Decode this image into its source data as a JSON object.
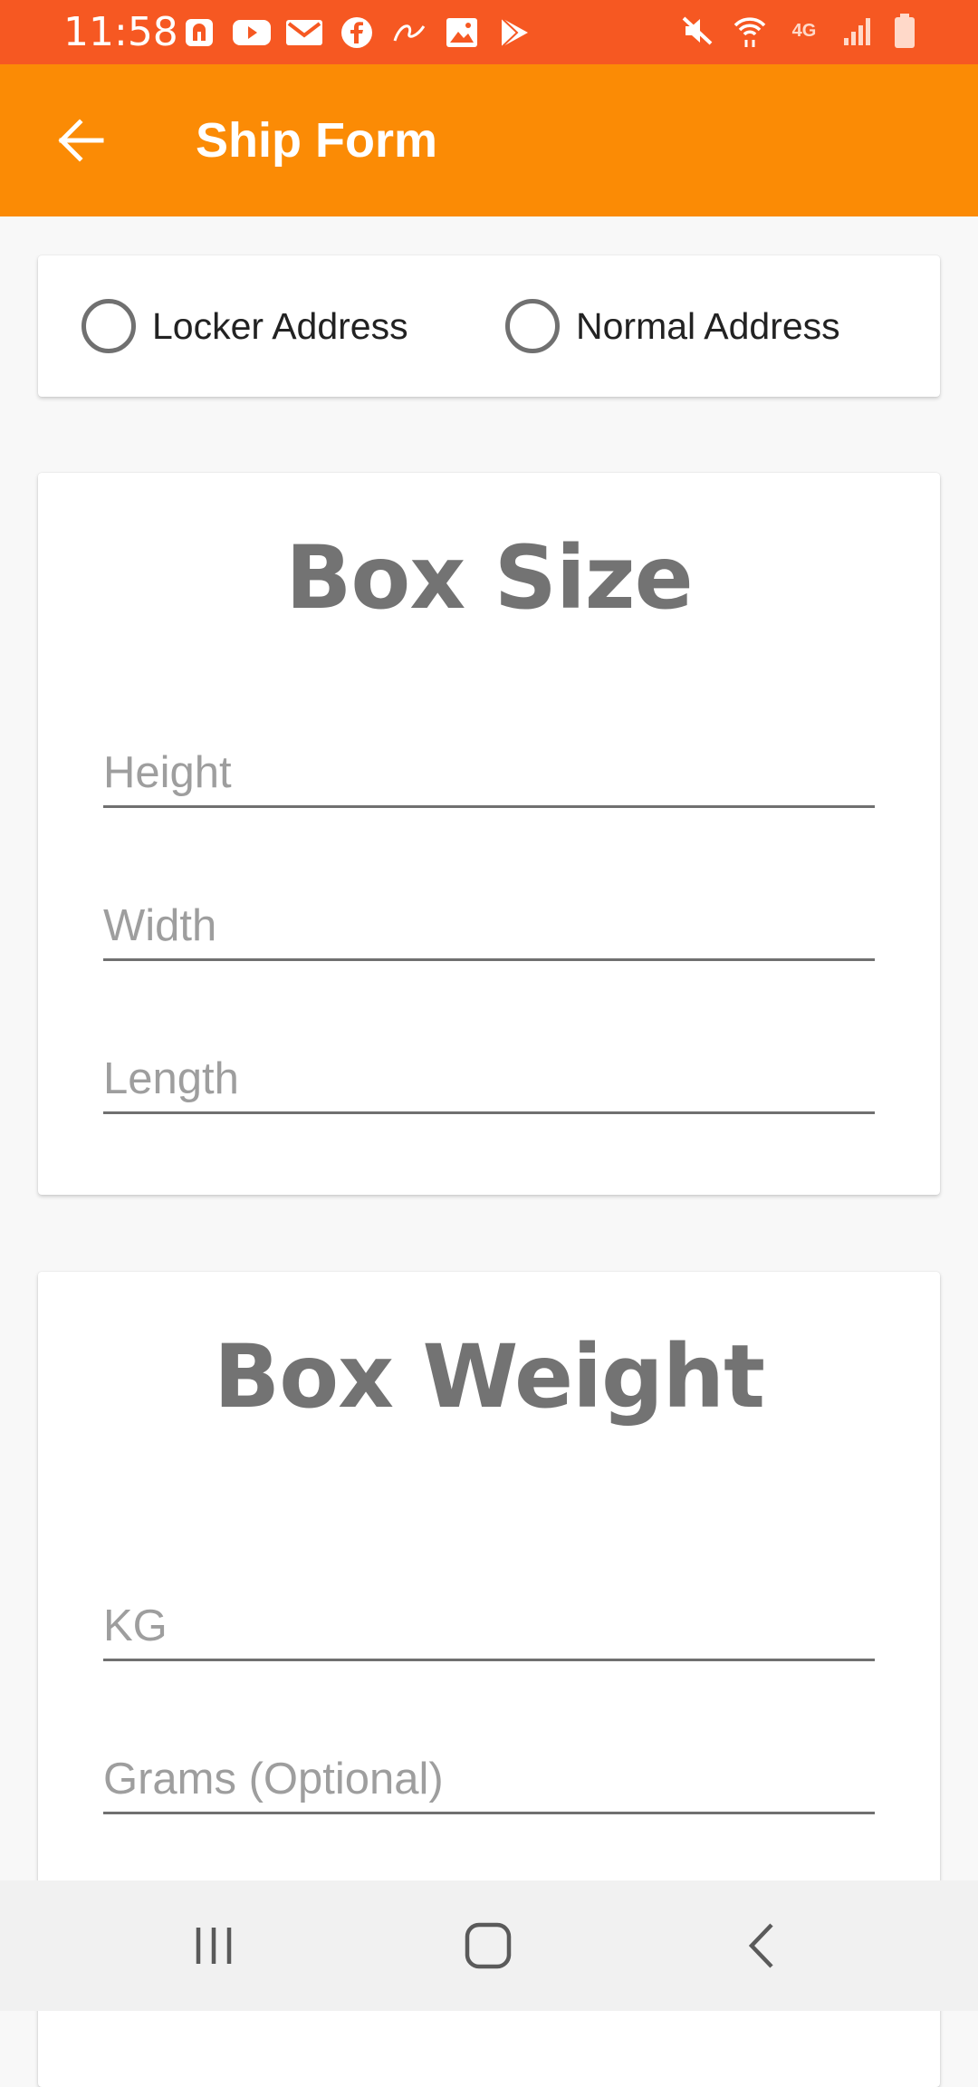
{
  "status_bar": {
    "time": "11:58",
    "left_icons": [
      "app-notification-icon",
      "youtube-icon",
      "gmail-icon",
      "facebook-icon",
      "app-icon",
      "gallery-icon",
      "play-store-icon"
    ],
    "right_icons": [
      "mute-icon",
      "wifi-icon",
      "lte-icon",
      "signal-icon",
      "battery-icon"
    ],
    "network_label": "4G",
    "color": "#f65822"
  },
  "app_bar": {
    "title": "Ship Form",
    "color": "#fb8b05"
  },
  "address_type": {
    "options": [
      {
        "label": "Locker Address",
        "selected": false
      },
      {
        "label": "Normal Address",
        "selected": false
      }
    ]
  },
  "box_size": {
    "heading": "Box Size",
    "fields": [
      {
        "placeholder": "Height",
        "value": ""
      },
      {
        "placeholder": "Width",
        "value": ""
      },
      {
        "placeholder": "Length",
        "value": ""
      }
    ]
  },
  "box_weight": {
    "heading": "Box Weight",
    "fields": [
      {
        "placeholder": "KG",
        "value": ""
      },
      {
        "placeholder": "Grams (Optional)",
        "value": ""
      }
    ]
  },
  "nav_bar": {
    "buttons": [
      "recent-apps-icon",
      "home-icon",
      "back-icon"
    ]
  }
}
